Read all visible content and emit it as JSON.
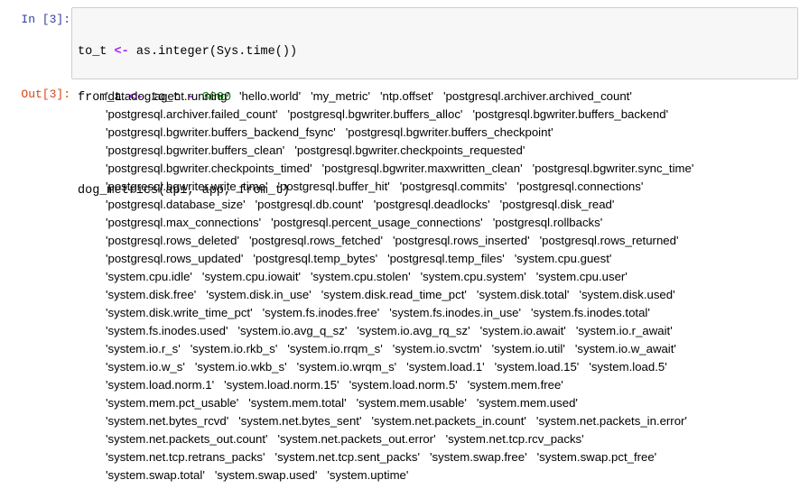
{
  "cell": {
    "in_prompt": "In [3]:",
    "out_prompt": "Out[3]:",
    "code": {
      "line1": {
        "a": "to_t ",
        "op": "<-",
        "b": " as.integer(Sys.time())"
      },
      "line2": {
        "a": "from_t ",
        "op": "<-",
        "b": " to_t ",
        "op2": "-",
        "num": " 3600"
      },
      "line3": {
        "fn": "dog_metrics",
        "args": "(api, app, from_t)"
      }
    },
    "output_lines": [
      [
        "'datadog.agent.running'",
        "'hello.world'",
        "'my_metric'",
        "'ntp.offset'",
        "'postgresql.archiver.archived_count'"
      ],
      [
        "'postgresql.archiver.failed_count'",
        "'postgresql.bgwriter.buffers_alloc'",
        "'postgresql.bgwriter.buffers_backend'"
      ],
      [
        "'postgresql.bgwriter.buffers_backend_fsync'",
        "'postgresql.bgwriter.buffers_checkpoint'"
      ],
      [
        "'postgresql.bgwriter.buffers_clean'",
        "'postgresql.bgwriter.checkpoints_requested'"
      ],
      [
        "'postgresql.bgwriter.checkpoints_timed'",
        "'postgresql.bgwriter.maxwritten_clean'",
        "'postgresql.bgwriter.sync_time'"
      ],
      [
        "'postgresql.bgwriter.write_time'",
        "'postgresql.buffer_hit'",
        "'postgresql.commits'",
        "'postgresql.connections'"
      ],
      [
        "'postgresql.database_size'",
        "'postgresql.db.count'",
        "'postgresql.deadlocks'",
        "'postgresql.disk_read'"
      ],
      [
        "'postgresql.max_connections'",
        "'postgresql.percent_usage_connections'",
        "'postgresql.rollbacks'"
      ],
      [
        "'postgresql.rows_deleted'",
        "'postgresql.rows_fetched'",
        "'postgresql.rows_inserted'",
        "'postgresql.rows_returned'"
      ],
      [
        "'postgresql.rows_updated'",
        "'postgresql.temp_bytes'",
        "'postgresql.temp_files'",
        "'system.cpu.guest'"
      ],
      [
        "'system.cpu.idle'",
        "'system.cpu.iowait'",
        "'system.cpu.stolen'",
        "'system.cpu.system'",
        "'system.cpu.user'"
      ],
      [
        "'system.disk.free'",
        "'system.disk.in_use'",
        "'system.disk.read_time_pct'",
        "'system.disk.total'",
        "'system.disk.used'"
      ],
      [
        "'system.disk.write_time_pct'",
        "'system.fs.inodes.free'",
        "'system.fs.inodes.in_use'",
        "'system.fs.inodes.total'"
      ],
      [
        "'system.fs.inodes.used'",
        "'system.io.avg_q_sz'",
        "'system.io.avg_rq_sz'",
        "'system.io.await'",
        "'system.io.r_await'"
      ],
      [
        "'system.io.r_s'",
        "'system.io.rkb_s'",
        "'system.io.rrqm_s'",
        "'system.io.svctm'",
        "'system.io.util'",
        "'system.io.w_await'"
      ],
      [
        "'system.io.w_s'",
        "'system.io.wkb_s'",
        "'system.io.wrqm_s'",
        "'system.load.1'",
        "'system.load.15'",
        "'system.load.5'"
      ],
      [
        "'system.load.norm.1'",
        "'system.load.norm.15'",
        "'system.load.norm.5'",
        "'system.mem.free'"
      ],
      [
        "'system.mem.pct_usable'",
        "'system.mem.total'",
        "'system.mem.usable'",
        "'system.mem.used'"
      ],
      [
        "'system.net.bytes_rcvd'",
        "'system.net.bytes_sent'",
        "'system.net.packets_in.count'",
        "'system.net.packets_in.error'"
      ],
      [
        "'system.net.packets_out.count'",
        "'system.net.packets_out.error'",
        "'system.net.tcp.rcv_packs'"
      ],
      [
        "'system.net.tcp.retrans_packs'",
        "'system.net.tcp.sent_packs'",
        "'system.swap.free'",
        "'system.swap.pct_free'"
      ],
      [
        "'system.swap.total'",
        "'system.swap.used'",
        "'system.uptime'"
      ]
    ]
  }
}
